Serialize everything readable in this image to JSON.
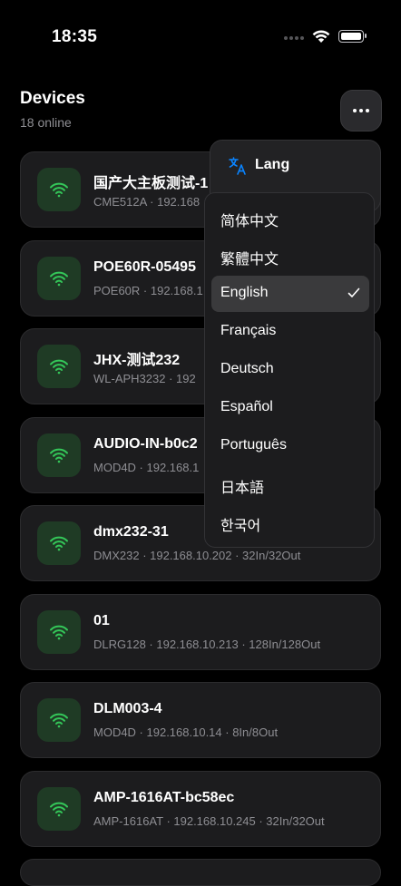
{
  "status_bar": {
    "time": "18:35"
  },
  "header": {
    "title": "Devices",
    "subtitle": "18 online"
  },
  "colors": {
    "background": "#000000",
    "card": "#1c1c1e",
    "icon_tile": "#1f3b25",
    "wifi_green": "#34c759",
    "accent_blue": "#0a84ff",
    "muted_text": "#8e8e93"
  },
  "devices": [
    {
      "name": "国产大主板测试-1",
      "meta": "CME512A · 192.168",
      "icon": "wifi-icon"
    },
    {
      "name": "POE60R-05495",
      "meta": "POE60R · 192.168.1",
      "icon": "wifi-icon"
    },
    {
      "name": "JHX-测试232",
      "meta": "WL-APH3232 · 192",
      "icon": "wifi-icon"
    },
    {
      "name": "AUDIO-IN-b0c2",
      "meta": "MOD4D · 192.168.1",
      "icon": "wifi-icon"
    },
    {
      "name": "dmx232-31",
      "meta": "DMX232 · 192.168.10.202 · 32In/32Out",
      "icon": "wifi-icon"
    },
    {
      "name": "01",
      "meta": "DLRG128 · 192.168.10.213 · 128In/128Out",
      "icon": "wifi-icon"
    },
    {
      "name": "DLM003-4",
      "meta": "MOD4D · 192.168.10.14 · 8In/8Out",
      "icon": "wifi-icon"
    },
    {
      "name": "AMP-1616AT-bc58ec",
      "meta": "AMP-1616AT · 192.168.10.245 · 32In/32Out",
      "icon": "wifi-icon"
    }
  ],
  "lang_popover": {
    "title": "Lang",
    "icon": "translate-icon"
  },
  "languages": [
    {
      "label": "简体中文",
      "selected": false
    },
    {
      "label": "繁體中文",
      "selected": false
    },
    {
      "label": "English",
      "selected": true
    },
    {
      "label": "Français",
      "selected": false
    },
    {
      "label": "Deutsch",
      "selected": false
    },
    {
      "label": "Español",
      "selected": false
    },
    {
      "label": "Português",
      "selected": false
    },
    {
      "label": "日本語",
      "selected": false
    },
    {
      "label": "한국어",
      "selected": false
    }
  ]
}
